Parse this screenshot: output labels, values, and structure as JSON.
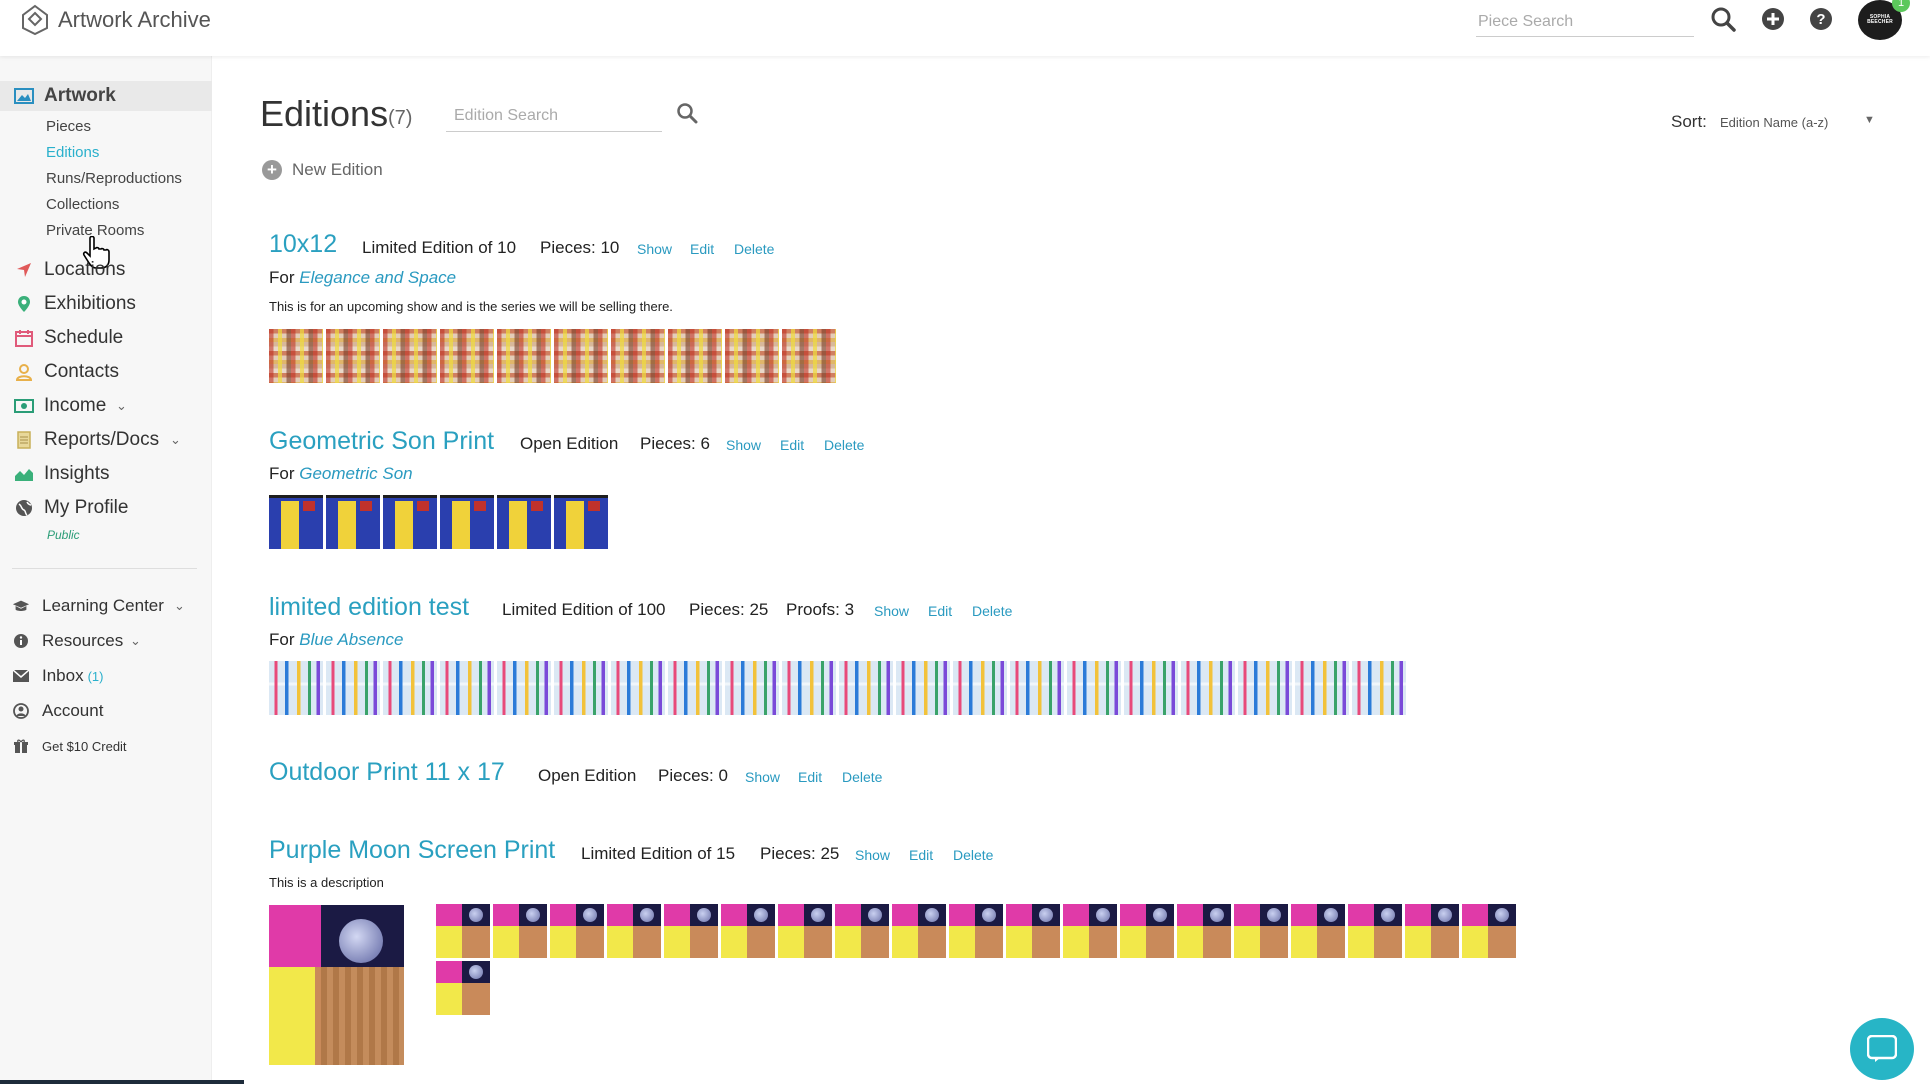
{
  "app": {
    "title": "Artwork Archive"
  },
  "header": {
    "search_placeholder": "Piece Search",
    "avatar_text": "SOPHIA BEECHER",
    "notification_count": "1"
  },
  "sidebar": {
    "artwork": "Artwork",
    "sub": [
      "Pieces",
      "Editions",
      "Runs/Reproductions",
      "Collections",
      "Private Rooms"
    ],
    "main": [
      "Locations",
      "Exhibitions",
      "Schedule",
      "Contacts",
      "Income",
      "Reports/Docs",
      "Insights",
      "My Profile"
    ],
    "profile_status": "Public",
    "secondary": {
      "learning": "Learning Center",
      "resources": "Resources",
      "inbox": "Inbox",
      "inbox_count": "(1)",
      "account": "Account",
      "credit": "Get $10 Credit"
    }
  },
  "page": {
    "title": "Editions",
    "count": "(7)",
    "search_placeholder": "Edition Search",
    "sort_label": "Sort:",
    "sort_value": "Edition Name (a-z)",
    "new_edition": "New Edition"
  },
  "actions": {
    "show": "Show",
    "edit": "Edit",
    "delete": "Delete"
  },
  "editions": [
    {
      "title": "10x12",
      "type": "Limited Edition of 10",
      "pieces": "Pieces: 10",
      "for_label": "For",
      "for_piece": "Elegance and Space",
      "description": "This is for an upcoming show and is the series we will be selling there.",
      "thumb_count": 10
    },
    {
      "title": "Geometric Son Print",
      "type": "Open Edition",
      "pieces": "Pieces: 6",
      "for_label": "For",
      "for_piece": "Geometric Son",
      "thumb_count": 6
    },
    {
      "title": "limited edition test",
      "type": "Limited Edition of 100",
      "pieces": "Pieces: 25",
      "proofs": "Proofs: 3",
      "for_label": "For",
      "for_piece": "Blue Absence",
      "thumb_count": 20
    },
    {
      "title": "Outdoor Print 11 x 17",
      "type": "Open Edition",
      "pieces": "Pieces: 0"
    },
    {
      "title": "Purple Moon Screen Print",
      "type": "Limited Edition of 15",
      "pieces": "Pieces: 25",
      "description": "This is a description",
      "thumb_count": 20
    }
  ]
}
